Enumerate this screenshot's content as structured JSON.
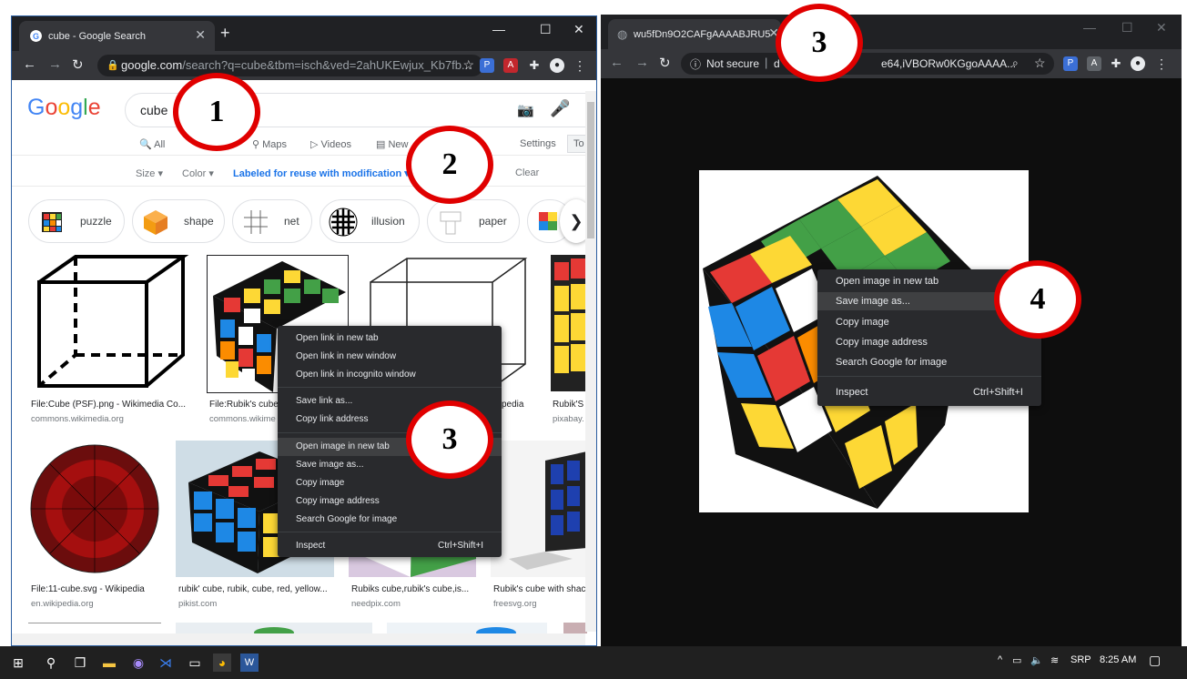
{
  "left_window": {
    "tab_title": "cube - Google Search",
    "url_main": "google.com",
    "url_rest": "/search?q=cube&tbm=isch&ved=2ahUKEwjux_Kb7fb...",
    "google_logo": "Google",
    "search_query": "cube",
    "nav_tabs": [
      "All",
      "Maps",
      "Videos",
      "New",
      "Settings",
      "To"
    ],
    "tools": {
      "size": "Size ▾",
      "color": "Color ▾",
      "license": "Labeled for reuse with modification ▾",
      "clear": "Clear"
    },
    "chips": [
      "puzzle",
      "shape",
      "net",
      "illusion",
      "paper"
    ],
    "results": [
      {
        "caption": "File:Cube (PSF).png - Wikimedia Co...",
        "source": "commons.wikimedia.org"
      },
      {
        "caption": "File:Rubik's cube",
        "source": "commons.wikime"
      },
      {
        "caption": "pedia",
        "source": ""
      },
      {
        "caption": "Rubik'S",
        "source": "pixabay."
      },
      {
        "caption": "File:11-cube.svg - Wikipedia",
        "source": "en.wikipedia.org"
      },
      {
        "caption": "rubik' cube, rubik, cube, red, yellow...",
        "source": "pikist.com"
      },
      {
        "caption": "Rubiks cube,rubik's cube,is...",
        "source": "needpix.com"
      },
      {
        "caption": "Rubik's cube with shac",
        "source": "freesvg.org"
      }
    ],
    "context_menu": {
      "items": [
        "Open link in new tab",
        "Open link in new window",
        "Open link in incognito window",
        "Save link as...",
        "Copy link address",
        "Open image in new tab",
        "Save image as...",
        "Copy image",
        "Copy image address",
        "Search Google for image",
        "Inspect"
      ],
      "inspect_shortcut": "Ctrl+Shift+I"
    }
  },
  "right_window": {
    "tab_title": "wu5fDn9O2CAFgAAAABJRU5Erk",
    "not_secure": "Not secure",
    "url_a": "d",
    "url_b": "e64,iVBORw0KGgoAAAA...",
    "context_menu": {
      "items": [
        "Open image in new tab",
        "Save image as...",
        "Copy image",
        "Copy image address",
        "Search Google for image",
        "Inspect"
      ],
      "inspect_shortcut": "Ctrl+Shift+I"
    }
  },
  "callouts": [
    "1",
    "2",
    "3",
    "3",
    "4"
  ],
  "taskbar": {
    "lang": "SRP",
    "time": "8:25 AM"
  },
  "colors": {
    "callout_ring": "#e00000",
    "chrome_dark": "#202124",
    "chrome_toolbar": "#35363a",
    "google_blue": "#1a73e8"
  }
}
